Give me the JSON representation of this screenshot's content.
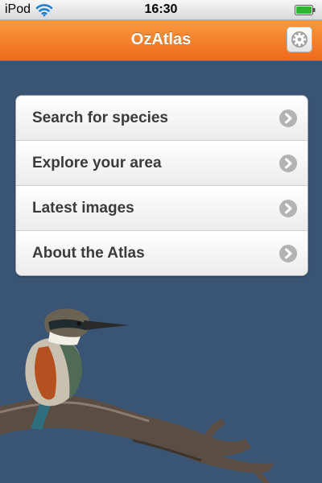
{
  "status_bar": {
    "carrier": "iPod",
    "time": "16:30",
    "wifi_icon": "wifi-icon",
    "battery_icon": "battery-icon",
    "battery_color": "#2fb52f"
  },
  "nav_bar": {
    "title": "OzAtlas",
    "settings_icon": "gear-icon",
    "accent_color": "#f37f2c"
  },
  "menu": {
    "items": [
      {
        "label": "Search for species",
        "icon": "chevron-right-icon"
      },
      {
        "label": "Explore your area",
        "icon": "chevron-right-icon"
      },
      {
        "label": "Latest images",
        "icon": "chevron-right-icon"
      },
      {
        "label": "About the Atlas",
        "icon": "chevron-right-icon"
      }
    ]
  },
  "background": {
    "color": "#3a5574",
    "image": "kingfisher-on-branch"
  }
}
